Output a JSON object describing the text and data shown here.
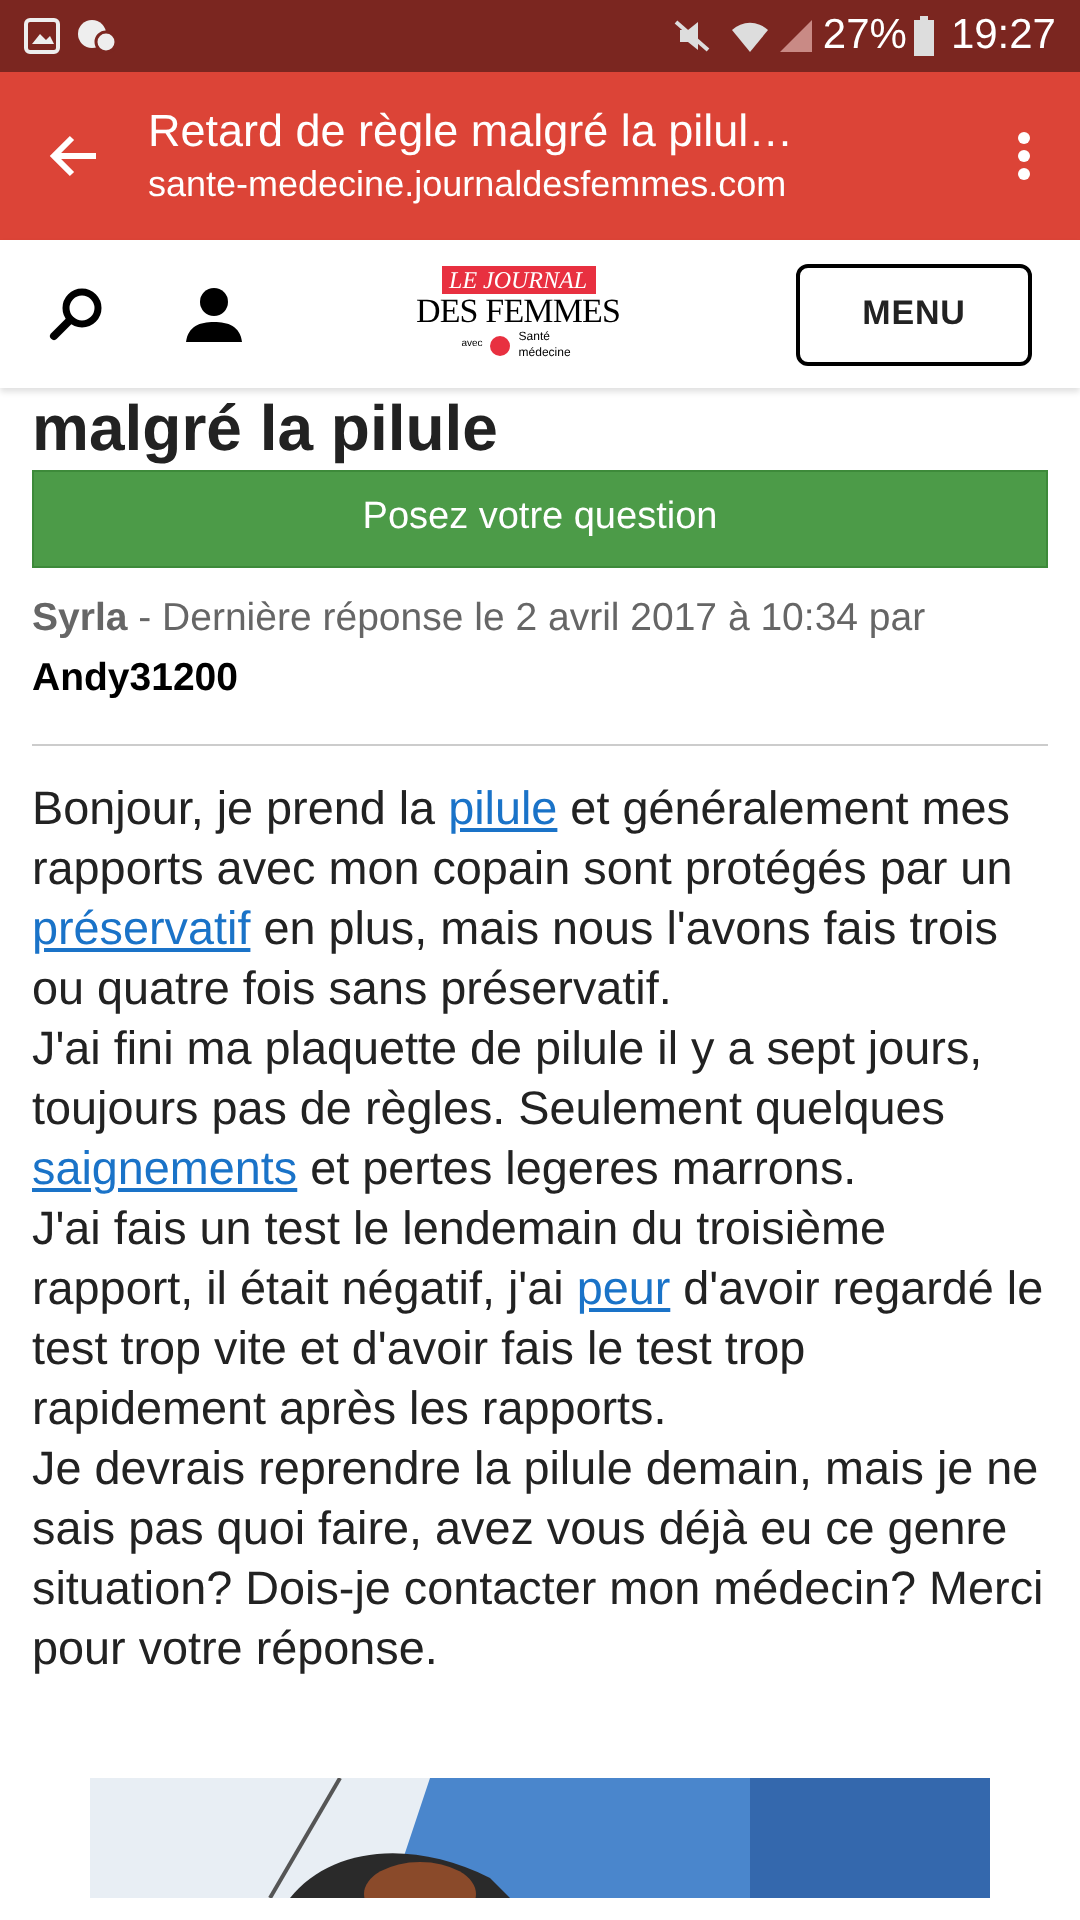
{
  "status_bar": {
    "battery": "27%",
    "time": "19:27"
  },
  "browser_bar": {
    "title": "Retard de règle malgré la pilul…",
    "url": "sante-medecine.journaldesfemmes.com"
  },
  "site_header": {
    "logo": {
      "top": "LE JOURNAL",
      "main": "DES FEMMES",
      "with": "avec",
      "partner": "Santé médecine"
    },
    "menu_button": "MENU"
  },
  "article": {
    "heading_fragment": "malgré la pilule",
    "ask_button": "Posez votre question",
    "meta": {
      "author": "Syrla",
      "text": "- Dernière réponse le 2 avril 2017 à 10:34 par",
      "last_replier": "Andy31200"
    },
    "paragraphs": [
      [
        {
          "text": "Bonjour, je prend la ",
          "link": false
        },
        {
          "text": "pilule",
          "link": true
        },
        {
          "text": " et généralement mes rapports avec mon copain sont protégés par un ",
          "link": false
        },
        {
          "text": "préservatif",
          "link": true
        },
        {
          "text": " en plus, mais nous l'avons fais trois ou quatre fois sans préservatif.",
          "link": false
        }
      ],
      [
        {
          "text": "J'ai fini ma plaquette de pilule il y a sept jours, toujours pas de règles. Seulement quelques ",
          "link": false
        },
        {
          "text": "saignements",
          "link": true
        },
        {
          "text": " et pertes legeres marrons.",
          "link": false
        }
      ],
      [
        {
          "text": "J'ai fais un test le lendemain du troisième rapport, il était négatif, j'ai ",
          "link": false
        },
        {
          "text": "peur",
          "link": true
        },
        {
          "text": " d'avoir regardé le test trop vite et d'avoir fais le test trop rapidement après les rapports.",
          "link": false
        }
      ],
      [
        {
          "text": "Je devrais reprendre la pilule demain, mais je ne sais pas quoi faire, avez vous déjà eu ce genre situation? Dois-je contacter mon médecin? Merci pour votre réponse.",
          "link": false
        }
      ]
    ],
    "image": {
      "kind": "picture"
    }
  }
}
